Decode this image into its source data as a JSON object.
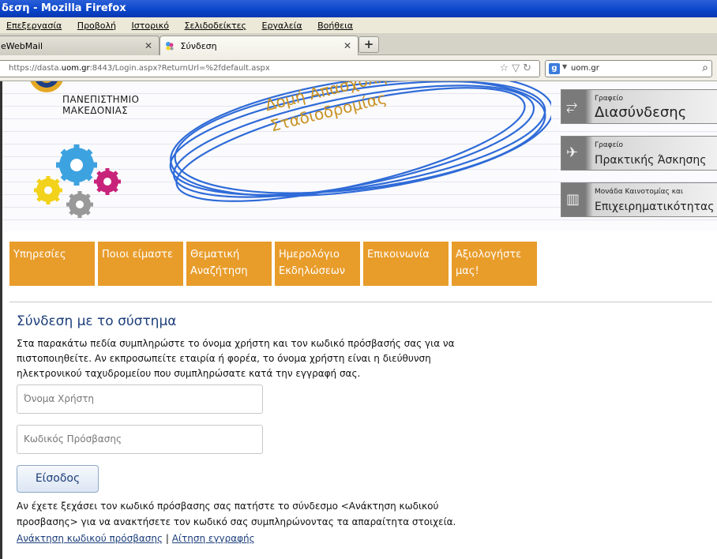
{
  "window": {
    "title": "δεση - Mozilla Firefox"
  },
  "menu": [
    "Επεξεργασία",
    "Προβολή",
    "Ιστορικό",
    "Σελιδοδείκτες",
    "Εργαλεία",
    "Βοήθεια"
  ],
  "tabs": [
    {
      "label": "eWebMail",
      "active": false
    },
    {
      "label": "Σύνδεση",
      "active": true
    }
  ],
  "url": {
    "prefix": "https://dasta.",
    "domain": "uom.gr",
    "rest": ":8443/Login.aspx?ReturnUrl=%2fdefault.aspx"
  },
  "search": {
    "value": "uom.gr",
    "engine": "g"
  },
  "banner": {
    "university": [
      "ΠΑΝΕΠΙΣΤΗΜΙΟ",
      "ΜΑΚΕΔΟΝΙΑΣ"
    ],
    "title_line1": "Δομή Απασχόλησης και",
    "title_line2": "Σταδιοδρομίας",
    "side_links": [
      {
        "small": "Γραφείο",
        "big": "Διασύνδεσης"
      },
      {
        "small": "Γραφείο",
        "big": "Πρακτικής Άσκησης"
      },
      {
        "small": "Μονάδα Καινοτομίας και",
        "big": "Επιχειρηματικότητας"
      }
    ]
  },
  "nav": [
    {
      "line1": "Υπηρεσίες",
      "line2": ""
    },
    {
      "line1": "Ποιοι είμαστε",
      "line2": ""
    },
    {
      "line1": "Θεματική",
      "line2": "Αναζήτηση"
    },
    {
      "line1": "Ημερολόγιο",
      "line2": "Εκδηλώσεων"
    },
    {
      "line1": "Επικοινωνία",
      "line2": ""
    },
    {
      "line1": "Αξιολογήστε",
      "line2": "μας!"
    }
  ],
  "login": {
    "title": "Σύνδεση με το σύστημα",
    "description": "Στα παρακάτω πεδία συμπληρώστε το όνομα χρήστη και τον κωδικό πρόσβασής σας για να πιστοποιηθείτε. Αν εκπροσωπείτε εταιρία ή φορέα, το όνομα χρήστη είναι η διεύθυνση ηλεκτρονικού ταχυδρομείου που συμπληρώσατε κατά την εγγραφή σας.",
    "username_placeholder": "Όνομα Χρήστη",
    "password_placeholder": "Κωδικός Πρόσβασης",
    "submit_label": "Είσοδος",
    "forgot_text": "Αν έχετε ξεχάσει τον κωδικό πρόσβασης σας πατήστε το σύνδεσμο <Ανάκτηση κωδικού προσβασης> για να ανακτήσετε τον κωδικό σας συμπληρώνοντας τα απαραίτητα στοιχεία.",
    "recover_link": "Ανάκτηση κωδικού πρόσβασης",
    "separator": "|",
    "register_link": "Αίτηση εγγραφής"
  },
  "colors": {
    "nav_orange": "#e89c2a",
    "title_blue": "#1c3e7a",
    "banner_gold": "#c99325",
    "scribble_blue": "#2f6bd8"
  }
}
